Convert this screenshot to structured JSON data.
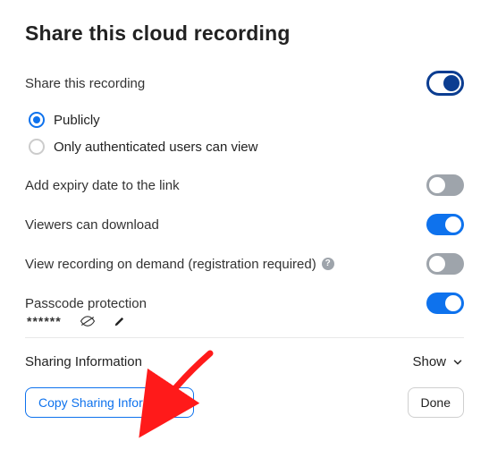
{
  "title": "Share this cloud recording",
  "share_recording": {
    "label": "Share this recording",
    "on": true
  },
  "visibility": {
    "publicly": {
      "label": "Publicly",
      "selected": true
    },
    "authenticated": {
      "label": "Only authenticated users can view",
      "selected": false
    }
  },
  "expiry": {
    "label": "Add expiry date to the link",
    "on": false
  },
  "download": {
    "label": "Viewers can download",
    "on": true
  },
  "on_demand": {
    "label": "View recording on demand (registration required)",
    "on": false
  },
  "passcode": {
    "label": "Passcode protection",
    "on": true,
    "masked": "******"
  },
  "sharing_info": {
    "label": "Sharing Information",
    "toggle_label": "Show"
  },
  "footer": {
    "copy_label": "Copy Sharing Information",
    "done_label": "Done"
  }
}
